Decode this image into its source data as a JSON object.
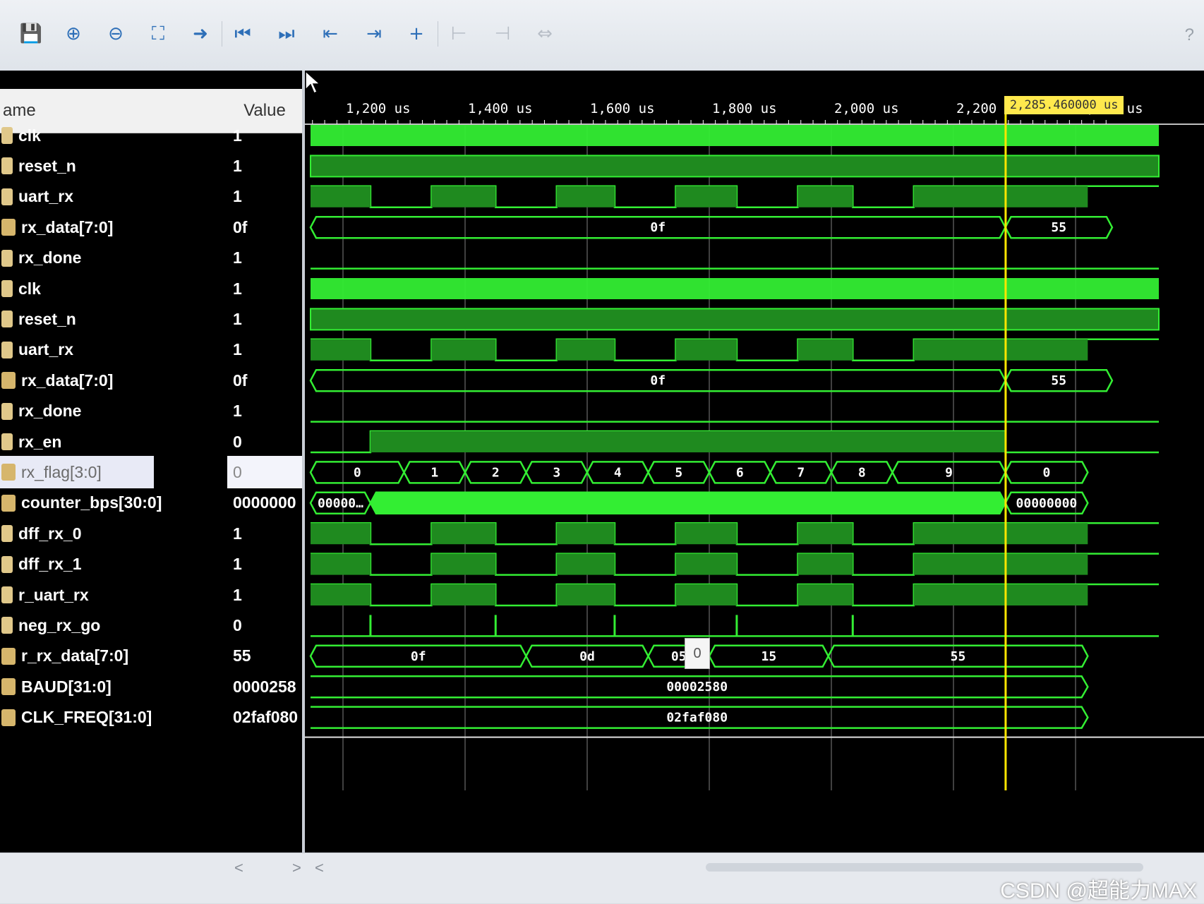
{
  "toolbar": {
    "buttons": [
      {
        "name": "save-button",
        "icon": "save-icon",
        "glyph": "💾",
        "enabled": true
      },
      {
        "name": "zoom-in-button",
        "icon": "zoom-in-icon",
        "glyph": "⊕",
        "enabled": true
      },
      {
        "name": "zoom-out-button",
        "icon": "zoom-out-icon",
        "glyph": "⊖",
        "enabled": true
      },
      {
        "name": "zoom-fit-button",
        "icon": "zoom-fit-icon",
        "glyph": "⛶",
        "enabled": true
      },
      {
        "name": "go-to-cursor-button",
        "icon": "go-to-cursor-icon",
        "glyph": "➜",
        "enabled": true
      },
      {
        "name": "go-to-start-button",
        "icon": "go-to-start-icon",
        "glyph": "⏮",
        "enabled": true
      },
      {
        "name": "go-to-end-button",
        "icon": "go-to-end-icon",
        "glyph": "⏭",
        "enabled": true
      },
      {
        "name": "previous-transition-button",
        "icon": "previous-transition-icon",
        "glyph": "⇤",
        "enabled": true
      },
      {
        "name": "next-transition-button",
        "icon": "next-transition-icon",
        "glyph": "⇥",
        "enabled": true
      },
      {
        "name": "add-marker-button",
        "icon": "add-marker-icon",
        "glyph": "+",
        "enabled": true
      },
      {
        "name": "previous-marker-button",
        "icon": "previous-marker-icon",
        "glyph": "⊢",
        "enabled": false
      },
      {
        "name": "next-marker-button",
        "icon": "next-marker-icon",
        "glyph": "⊣",
        "enabled": false
      },
      {
        "name": "swap-cursors-button",
        "icon": "swap-cursors-icon",
        "glyph": "⇔",
        "enabled": false
      }
    ],
    "help_label": "?"
  },
  "headers": {
    "name": "ame",
    "value": "Value"
  },
  "signals": [
    {
      "name": "clk",
      "value": "1",
      "bus": false
    },
    {
      "name": "reset_n",
      "value": "1",
      "bus": false
    },
    {
      "name": "uart_rx",
      "value": "1",
      "bus": false
    },
    {
      "name": "rx_data[7:0]",
      "value": "0f",
      "bus": true
    },
    {
      "name": "rx_done",
      "value": "1",
      "bus": false
    },
    {
      "name": "clk",
      "value": "1",
      "bus": false
    },
    {
      "name": "reset_n",
      "value": "1",
      "bus": false
    },
    {
      "name": "uart_rx",
      "value": "1",
      "bus": false
    },
    {
      "name": "rx_data[7:0]",
      "value": "0f",
      "bus": true
    },
    {
      "name": "rx_done",
      "value": "1",
      "bus": false
    },
    {
      "name": "rx_en",
      "value": "0",
      "bus": false
    },
    {
      "name": "rx_flag[3:0]",
      "value": "0",
      "bus": true,
      "selected": true
    },
    {
      "name": "counter_bps[30:0]",
      "value": "0000000",
      "bus": true
    },
    {
      "name": "dff_rx_0",
      "value": "1",
      "bus": false
    },
    {
      "name": "dff_rx_1",
      "value": "1",
      "bus": false
    },
    {
      "name": "r_uart_rx",
      "value": "1",
      "bus": false
    },
    {
      "name": "neg_rx_go",
      "value": "0",
      "bus": false
    },
    {
      "name": "r_rx_data[7:0]",
      "value": "55",
      "bus": true
    },
    {
      "name": "BAUD[31:0]",
      "value": "0000258",
      "bus": true
    },
    {
      "name": "CLK_FREQ[31:0]",
      "value": "02faf080",
      "bus": true
    }
  ],
  "timeline": {
    "ticks": [
      "1,200 us",
      "1,400 us",
      "1,600 us",
      "1,800 us",
      "2,000 us",
      "2,200 us",
      "2,400 us"
    ],
    "cursor_label": "2,285.460000 us",
    "cursor_time_us": 2285.46
  },
  "waves": {
    "rx_data_values": [
      "0f",
      "55"
    ],
    "rx_flag_values": [
      "0",
      "1",
      "2",
      "3",
      "4",
      "5",
      "6",
      "7",
      "8",
      "9",
      "0"
    ],
    "counter_bps_values": [
      "00000…",
      "00000000"
    ],
    "r_rx_data_values": [
      "0f",
      "0d",
      "05",
      "15",
      "55"
    ],
    "baud_value": "00002580",
    "clk_freq_value": "02faf080"
  },
  "tooltip": {
    "text": "0"
  },
  "statusbar": {
    "scroll_left": "<",
    "scroll_right": ">",
    "scroll_left_2": "<",
    "watermark": "CSDN @超能力MAX"
  },
  "colors": {
    "wave_green": "#33ee33",
    "wave_dark_green": "#1f8a1f",
    "cursor_yellow": "#ffe600",
    "background": "#000000"
  }
}
